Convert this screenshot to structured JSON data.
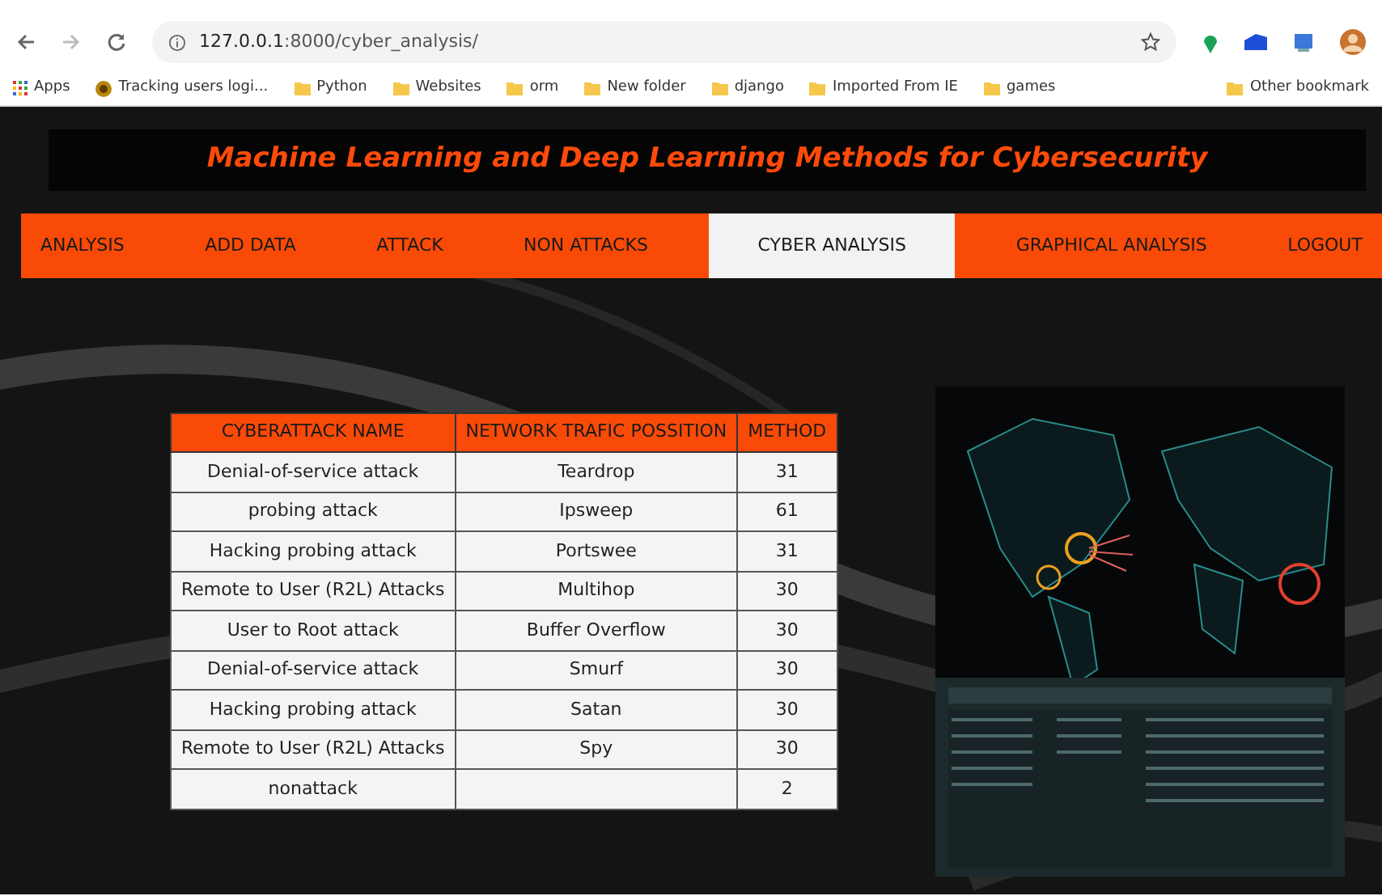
{
  "browser": {
    "url_host": "127.0.0.1",
    "url_rest": ":8000/cyber_analysis/",
    "bookmarks": [
      {
        "label": "Apps",
        "kind": "apps"
      },
      {
        "label": "Tracking users logi...",
        "kind": "site"
      },
      {
        "label": "Python",
        "kind": "folder"
      },
      {
        "label": "Websites",
        "kind": "folder"
      },
      {
        "label": "orm",
        "kind": "folder"
      },
      {
        "label": "New folder",
        "kind": "folder"
      },
      {
        "label": "django",
        "kind": "folder"
      },
      {
        "label": "Imported From IE",
        "kind": "folder"
      },
      {
        "label": "games",
        "kind": "folder"
      }
    ],
    "other_bookmarks": "Other bookmark"
  },
  "title": "Machine Learning and Deep Learning Methods for Cybersecurity",
  "nav": [
    {
      "label": "ANALYSIS",
      "selected": false
    },
    {
      "label": "ADD DATA",
      "selected": false
    },
    {
      "label": "ATTACK",
      "selected": false
    },
    {
      "label": "NON ATTACKS",
      "selected": false
    },
    {
      "label": "CYBER ANALYSIS",
      "selected": true
    },
    {
      "label": "GRAPHICAL ANALYSIS",
      "selected": false
    },
    {
      "label": "LOGOUT",
      "selected": false
    }
  ],
  "table": {
    "columns": [
      "CYBERATTACK NAME",
      "NETWORK TRAFIC POSSITION",
      "METHOD"
    ],
    "rows": [
      [
        "Denial-of-service attack",
        "Teardrop",
        "31"
      ],
      [
        "probing attack",
        "Ipsweep",
        "61"
      ],
      [
        "Hacking probing attack",
        "Portswee",
        "31"
      ],
      [
        "Remote to User (R2L) Attacks",
        "Multihop",
        "30"
      ],
      [
        "User to Root attack",
        "Buffer Overflow",
        "30"
      ],
      [
        "Denial-of-service attack",
        "Smurf",
        "30"
      ],
      [
        "Hacking probing attack",
        "Satan",
        "30"
      ],
      [
        "Remote to User (R2L) Attacks",
        "Spy",
        "30"
      ],
      [
        "nonattack",
        "",
        "2"
      ]
    ]
  }
}
